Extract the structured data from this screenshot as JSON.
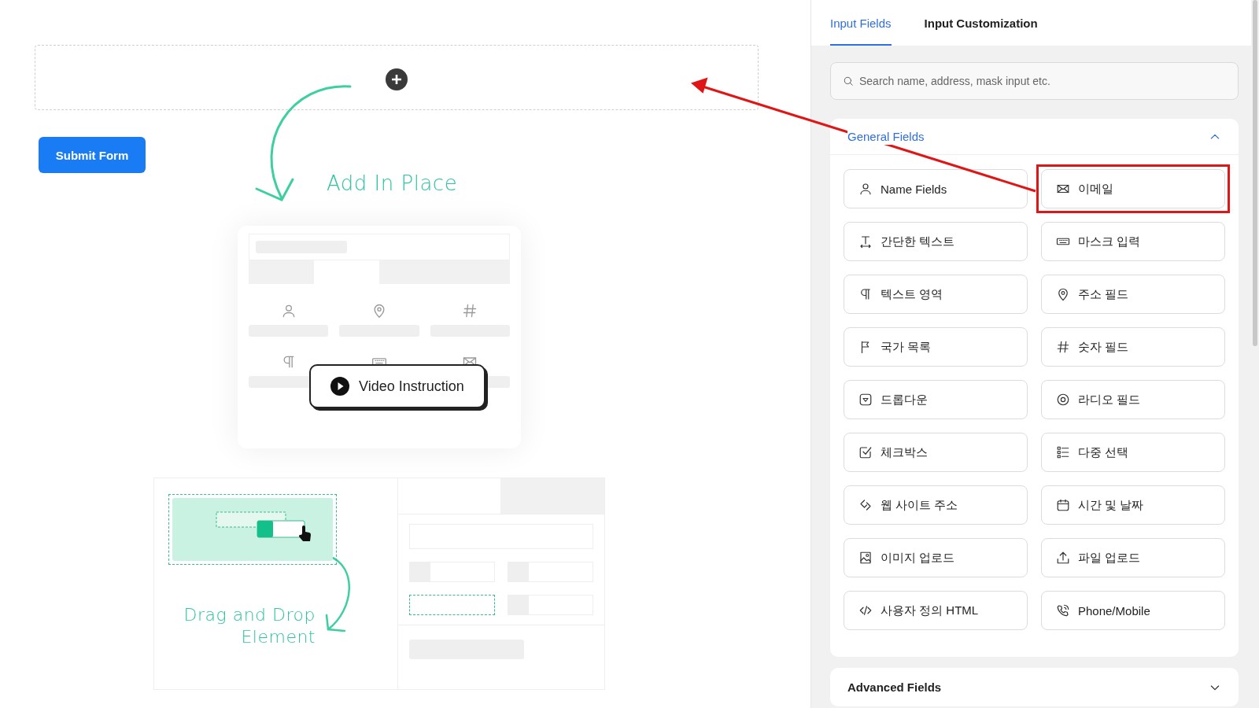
{
  "form": {
    "submit_button": "Submit Form"
  },
  "illustration": {
    "add_label": "Add In Place",
    "video_button": "Video Instruction",
    "drag_label": "Drag and Drop Element"
  },
  "tabs": [
    {
      "label": "Input Fields",
      "selected": true
    },
    {
      "label": "Input Customization",
      "selected": false
    }
  ],
  "search": {
    "placeholder": "Search name, address, mask input etc."
  },
  "sections": [
    {
      "title": "General Fields",
      "expanded": true,
      "items": [
        {
          "label": "Name Fields",
          "highlighted": false
        },
        {
          "label": "이메일",
          "highlighted": true
        },
        {
          "label": "간단한 텍스트",
          "highlighted": false
        },
        {
          "label": "마스크 입력",
          "highlighted": false
        },
        {
          "label": "텍스트 영역",
          "highlighted": false
        },
        {
          "label": "주소 필드",
          "highlighted": false
        },
        {
          "label": "국가 목록",
          "highlighted": false
        },
        {
          "label": "숫자 필드",
          "highlighted": false
        },
        {
          "label": "드롭다운",
          "highlighted": false
        },
        {
          "label": "라디오 필드",
          "highlighted": false
        },
        {
          "label": "체크박스",
          "highlighted": false
        },
        {
          "label": "다중 선택",
          "highlighted": false
        },
        {
          "label": "웹 사이트 주소",
          "highlighted": false
        },
        {
          "label": "시간 및 날짜",
          "highlighted": false
        },
        {
          "label": "이미지 업로드",
          "highlighted": false
        },
        {
          "label": "파일 업로드",
          "highlighted": false
        },
        {
          "label": "사용자 정의 HTML",
          "highlighted": false
        },
        {
          "label": "Phone/Mobile",
          "highlighted": false
        }
      ]
    },
    {
      "title": "Advanced Fields",
      "expanded": false
    }
  ]
}
